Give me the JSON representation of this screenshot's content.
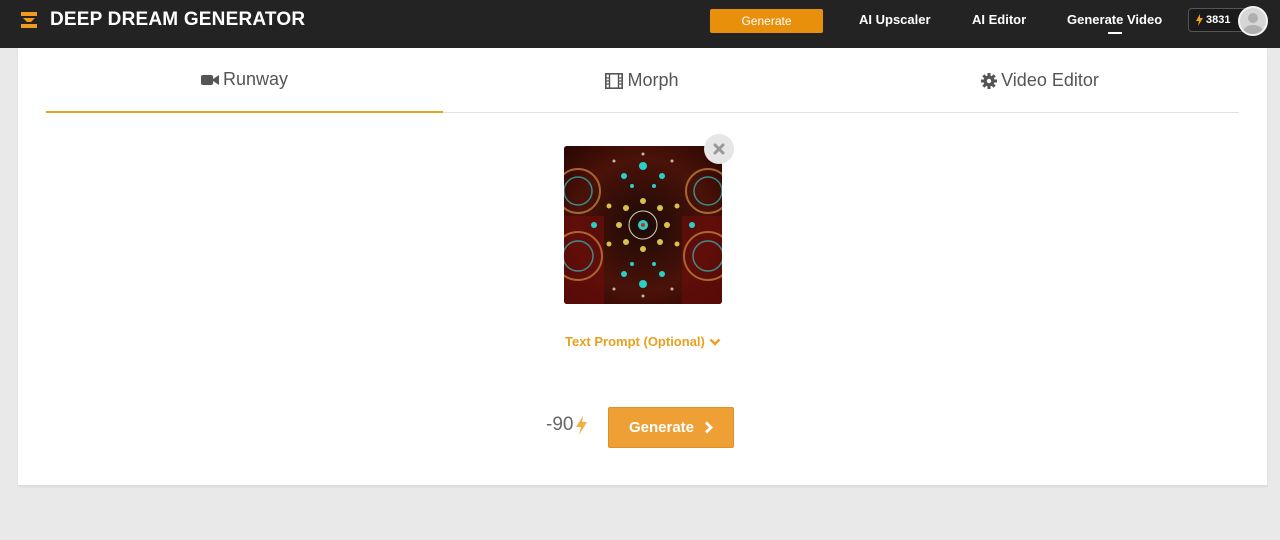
{
  "header": {
    "brand": "DEEP DREAM GENERATOR",
    "generate_label": "Generate",
    "nav": {
      "upscaler": "AI Upscaler",
      "editor": "AI Editor",
      "video": "Generate Video"
    },
    "credits": "3831"
  },
  "tabs": [
    {
      "label": "Runway",
      "icon": "video-camera-icon",
      "active": true
    },
    {
      "label": "Morph",
      "icon": "film-icon",
      "active": false
    },
    {
      "label": "Video Editor",
      "icon": "gear-icon",
      "active": false
    }
  ],
  "main": {
    "text_prompt_label": "Text Prompt (Optional)",
    "cost": "-90",
    "generate_label": "Generate"
  },
  "colors": {
    "accent": "#e8a020",
    "topbar": "#232323",
    "button": "#eea034"
  }
}
